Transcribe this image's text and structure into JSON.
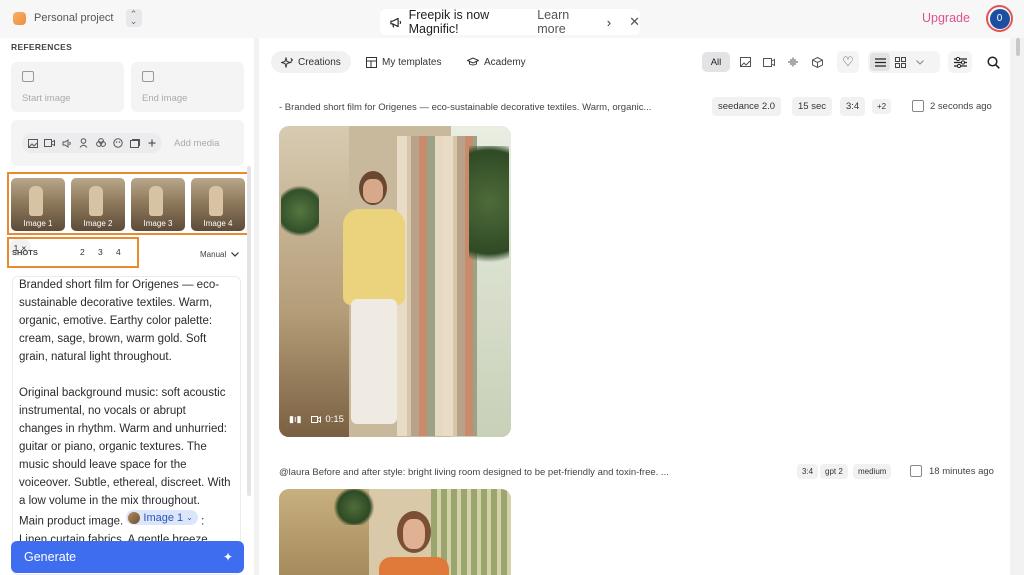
{
  "topbar": {
    "project_name": "Personal project",
    "banner_text": "Freepik is now Magnific!",
    "banner_link": "Learn more",
    "upgrade_label": "Upgrade",
    "avatar_initial": "0"
  },
  "sidebar": {
    "references_title": "REFERENCES",
    "start_image": "Start image",
    "end_image": "End image",
    "add_media": "Add media",
    "images": [
      {
        "label": "Image 1"
      },
      {
        "label": "Image 2"
      },
      {
        "label": "Image 3"
      },
      {
        "label": "Image 4"
      }
    ],
    "shots_label": "SHOTS",
    "shots": [
      "1",
      "2",
      "3",
      "4"
    ],
    "shot_remove": "×",
    "mode": "Manual",
    "prompt_paragraph_1": "Branded short film for Origenes — eco-sustainable decorative textiles. Warm, organic, emotive. Earthy color palette: cream, sage, brown, warm gold. Soft grain, natural light throughout.",
    "prompt_paragraph_2": "Original background music: soft acoustic instrumental, no vocals or abrupt changes in rhythm. Warm and unhurried: guitar or piano, organic textures. The music should leave space for the voiceover. Subtle, ethereal, discreet. With a low volume in the mix throughout.",
    "prompt_line_3_prefix": "Main product image.",
    "prompt_chip": "Image 1",
    "prompt_line_3_suffix": ":",
    "prompt_line_4": "Linen curtain fabrics. A gentle breeze",
    "generate_label": "Generate"
  },
  "main": {
    "tabs": [
      {
        "label": "Creations",
        "icon": "sparkles-icon"
      },
      {
        "label": "My templates",
        "icon": "template-icon"
      },
      {
        "label": "Academy",
        "icon": "graduation-cap-icon"
      }
    ],
    "filter_all": "All",
    "generations": [
      {
        "description": "- Branded short film for Origenes — eco-sustainable decorative textiles. Warm, organic...",
        "tags": [
          "seedance 2.0",
          "15 sec",
          "3:4",
          "+2"
        ],
        "time_ago": "2 seconds ago",
        "duration": "0:15"
      },
      {
        "description": "@laura Before and after style: bright living room designed to be pet-friendly and toxin-free. ...",
        "tags": [
          "3:4",
          "gpt 2",
          "medium"
        ],
        "time_ago": "18 minutes ago"
      }
    ]
  },
  "colors": {
    "accent": "#3e6df0",
    "highlight_outline": "#e78a32",
    "upgrade": "#e0518f"
  }
}
